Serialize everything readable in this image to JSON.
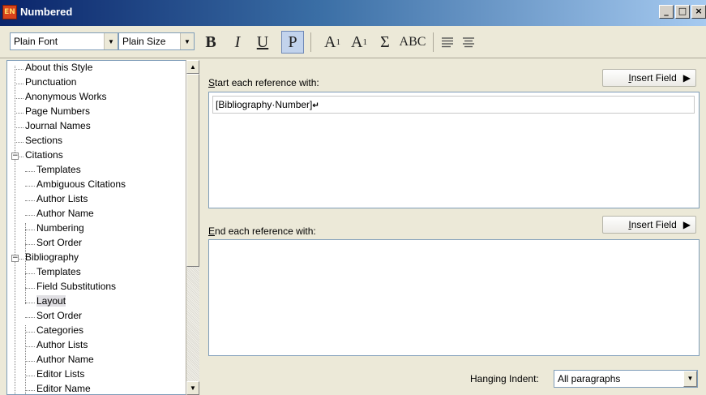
{
  "window": {
    "app_icon": "EN",
    "title": "Numbered",
    "controls": [
      "_",
      "□",
      "×"
    ]
  },
  "toolbar": {
    "font_combo": "Plain Font",
    "size_combo": "Plain Size",
    "bold": "B",
    "italic": "I",
    "underline": "U",
    "plain": "P",
    "superscript": "A",
    "superscript_mark": "1",
    "subscript": "A",
    "subscript_mark": "1",
    "symbol": "Σ",
    "smallcaps": "ABC"
  },
  "tree": {
    "items": [
      {
        "label": "About this Style"
      },
      {
        "label": "Punctuation"
      },
      {
        "label": "Anonymous Works"
      },
      {
        "label": "Page Numbers"
      },
      {
        "label": "Journal Names"
      },
      {
        "label": "Sections"
      },
      {
        "label": "Citations",
        "expander": "−"
      },
      {
        "label": "Templates"
      },
      {
        "label": "Ambiguous Citations"
      },
      {
        "label": "Author Lists"
      },
      {
        "label": "Author Name"
      },
      {
        "label": "Numbering"
      },
      {
        "label": "Sort Order"
      },
      {
        "label": "Bibliography",
        "expander": "−"
      },
      {
        "label": "Templates"
      },
      {
        "label": "Field Substitutions"
      },
      {
        "label": "Layout",
        "selected": true
      },
      {
        "label": "Sort Order"
      },
      {
        "label": "Categories"
      },
      {
        "label": "Author Lists"
      },
      {
        "label": "Author Name"
      },
      {
        "label": "Editor Lists"
      },
      {
        "label": "Editor Name"
      }
    ]
  },
  "layout": {
    "start_label_acc": "S",
    "start_label_rest": "tart each reference with:",
    "insert_field_1_acc": "I",
    "insert_field_1_rest": "nsert Field",
    "start_value": "[Bibliography·Number]",
    "start_caret": "↵",
    "end_label_acc": "E",
    "end_label_rest": "nd each reference with:",
    "insert_field_2_acc": "I",
    "insert_field_2_rest": "nsert Field",
    "hanging_indent_label": "Hanging Indent:",
    "hanging_indent_value": "All paragraphs"
  },
  "colors": {
    "title_bar_start": "#0a246a",
    "title_bar_end": "#a6caf0",
    "face": "#ece9d8",
    "border": "#7f9db9"
  }
}
